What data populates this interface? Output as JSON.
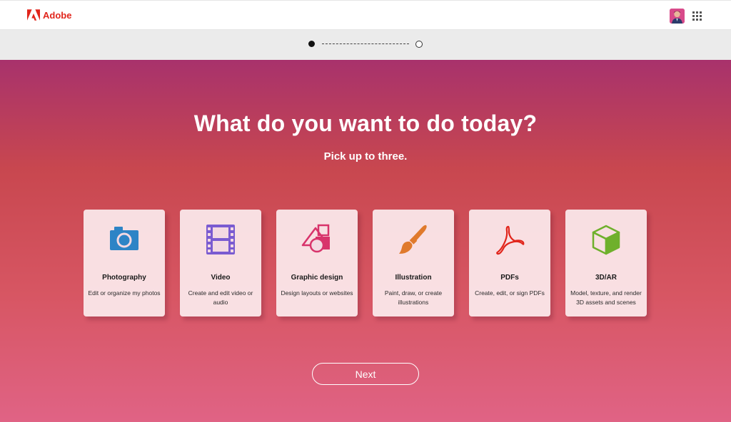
{
  "header": {
    "brand": "Adobe",
    "brand_color": "#e1251b",
    "avatar_icon": "user-avatar",
    "apps_icon": "apps-grid-icon"
  },
  "stepper": {
    "current_step": 1,
    "total_steps": 2
  },
  "main": {
    "title": "What do you want to do today?",
    "subtitle": "Pick up to three.",
    "cards": [
      {
        "title": "Photography",
        "description": "Edit or organize my photos",
        "icon": "camera-icon",
        "icon_color": "#2d84c6"
      },
      {
        "title": "Video",
        "description": "Create and edit video or audio",
        "icon": "film-icon",
        "icon_color": "#7a5bd1"
      },
      {
        "title": "Graphic design",
        "description": "Design layouts or websites",
        "icon": "shapes-icon",
        "icon_color": "#d8336b"
      },
      {
        "title": "Illustration",
        "description": "Paint, draw, or create illustrations",
        "icon": "paintbrush-icon",
        "icon_color": "#e07a2c"
      },
      {
        "title": "PDFs",
        "description": "Create, edit, or sign PDFs",
        "icon": "acrobat-icon",
        "icon_color": "#e1251b"
      },
      {
        "title": "3D/AR",
        "description": "Model, texture, and render 3D assets and scenes",
        "icon": "cube-icon",
        "icon_color": "#6fb02c"
      }
    ],
    "next_label": "Next"
  },
  "colors": {
    "gradient_top": "#a8326c",
    "gradient_bottom": "#e06385"
  }
}
